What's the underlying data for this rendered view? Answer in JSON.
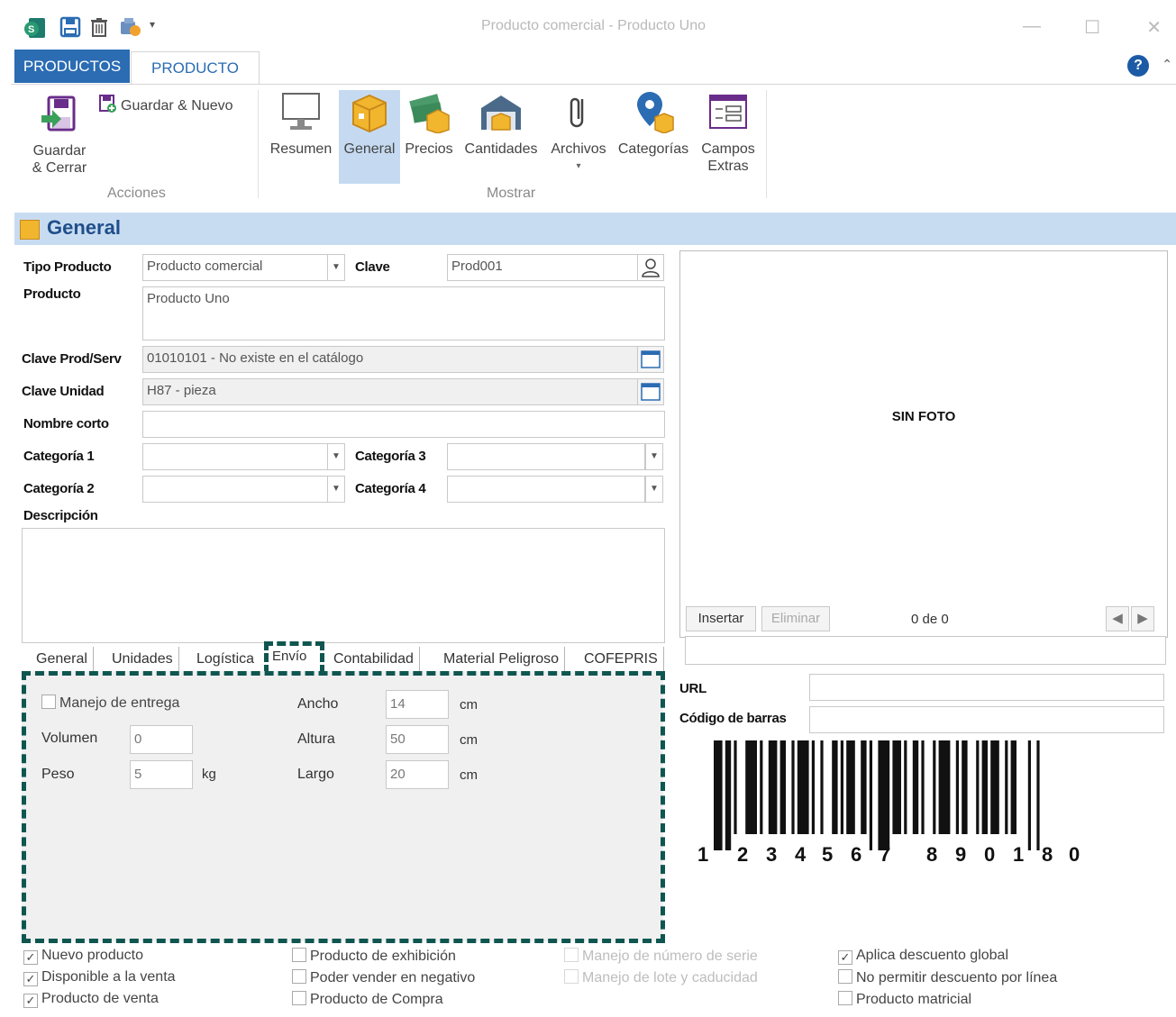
{
  "window": {
    "title": "Producto comercial - Producto Uno"
  },
  "tabs": {
    "productos": "PRODUCTOS",
    "producto": "PRODUCTO"
  },
  "ribbon": {
    "acciones": {
      "label": "Acciones",
      "guardar_cerrar": "Guardar\n& Cerrar",
      "guardar_nuevo": "Guardar & Nuevo"
    },
    "mostrar": {
      "label": "Mostrar",
      "items": [
        "Resumen",
        "General",
        "Precios",
        "Cantidades",
        "Archivos",
        "Categorías",
        "Campos\nExtras"
      ]
    }
  },
  "section": {
    "title": "General"
  },
  "form": {
    "tipo_producto": {
      "label": "Tipo Producto",
      "value": "Producto comercial"
    },
    "clave": {
      "label": "Clave",
      "value": "Prod001"
    },
    "producto": {
      "label": "Producto",
      "value": "Producto Uno"
    },
    "clave_prodserv": {
      "label": "Clave Prod/Serv",
      "value": "01010101 - No existe en el catálogo"
    },
    "clave_unidad": {
      "label": "Clave Unidad",
      "value": "H87 - pieza"
    },
    "nombre_corto": {
      "label": "Nombre corto",
      "value": ""
    },
    "categoria1": {
      "label": "Categoría 1",
      "value": ""
    },
    "categoria2": {
      "label": "Categoría 2",
      "value": ""
    },
    "categoria3": {
      "label": "Categoría 3",
      "value": ""
    },
    "categoria4": {
      "label": "Categoría 4",
      "value": ""
    },
    "descripcion": {
      "label": "Descripción",
      "value": ""
    }
  },
  "photo": {
    "placeholder": "SIN FOTO",
    "insertar": "Insertar",
    "eliminar": "Eliminar",
    "counter": "0 de 0"
  },
  "url": {
    "label": "URL",
    "value": ""
  },
  "codigo_barras": {
    "label": "Código de barras",
    "value": "",
    "digits": [
      "1",
      "2",
      "3",
      "4",
      "5",
      "6",
      "7",
      "8",
      "9",
      "0",
      "1",
      "8",
      "0"
    ]
  },
  "inner_tabs": [
    "General",
    "Unidades",
    "Logística",
    "Envío",
    "Contabilidad",
    "Material Peligroso",
    "COFEPRIS"
  ],
  "envio": {
    "manejo_entrega": "Manejo de entrega",
    "volumen": {
      "label": "Volumen",
      "value": "0"
    },
    "peso": {
      "label": "Peso",
      "value": "5",
      "unit": "kg"
    },
    "ancho": {
      "label": "Ancho",
      "value": "14",
      "unit": "cm"
    },
    "altura": {
      "label": "Altura",
      "value": "50",
      "unit": "cm"
    },
    "largo": {
      "label": "Largo",
      "value": "20",
      "unit": "cm"
    }
  },
  "checkboxes": [
    {
      "label": "Nuevo producto",
      "checked": true,
      "enabled": true
    },
    {
      "label": "Disponible a la venta",
      "checked": true,
      "enabled": true
    },
    {
      "label": "Producto de venta",
      "checked": true,
      "enabled": true
    },
    {
      "label": "Producto de exhibición",
      "checked": false,
      "enabled": true
    },
    {
      "label": "Poder vender en negativo",
      "checked": false,
      "enabled": true
    },
    {
      "label": "Producto de Compra",
      "checked": false,
      "enabled": true
    },
    {
      "label": "Manejo de número de serie",
      "checked": false,
      "enabled": false
    },
    {
      "label": "Manejo de lote y caducidad",
      "checked": false,
      "enabled": false
    },
    {
      "label": "Aplica descuento global",
      "checked": true,
      "enabled": true
    },
    {
      "label": "No permitir descuento por línea",
      "checked": false,
      "enabled": true
    },
    {
      "label": "Producto matricial",
      "checked": false,
      "enabled": true
    }
  ],
  "colors": {
    "accent": "#2b6cb3",
    "header_bg": "#c8dcf1",
    "highlight": "#c5daf1",
    "dash": "#0f5650"
  }
}
